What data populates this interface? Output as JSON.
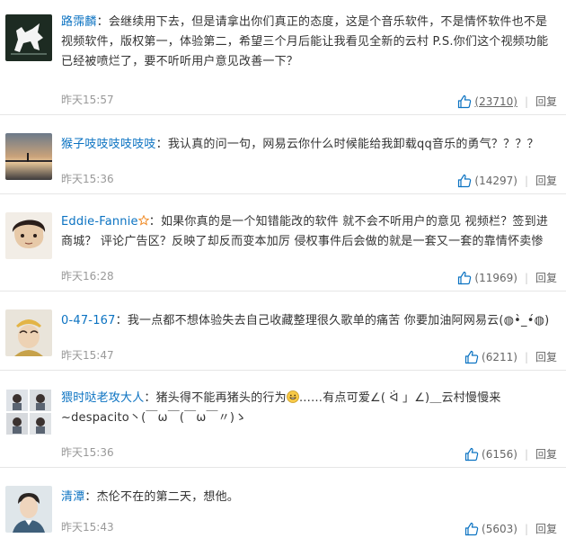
{
  "comments": [
    {
      "username": "路霈麟",
      "colon": "：",
      "text": "会继续用下去，但是请拿出你们真正的态度，这是个音乐软件，不是情怀软件也不是视频软件，版权第一，体验第二，希望三个月后能让我看见全新的云村 P.S.你们这个视频功能已经被喷烂了，要不听听用户意见改善一下？",
      "time": "昨天15:57",
      "likes": "(23710)",
      "reply": "回复",
      "avatar_icon": "white-dog-on-dark-avatar"
    },
    {
      "username": "猴子吱吱吱吱吱吱",
      "colon": "：",
      "text": "我认真的问一句，网易云你什么时候能给我卸载qq音乐的勇气？？？？",
      "time": "昨天15:36",
      "likes": "(14297)",
      "reply": "回复",
      "avatar_icon": "sunset-landscape-avatar"
    },
    {
      "username": "Eddie-Fannie",
      "colon": "：",
      "text": "如果你真的是一个知错能改的软件 就不会不听用户的意见 视频栏？签到进商城？ 评论广告区？反映了却反而变本加厉 侵权事件后会做的就是一套又一套的靠情怀卖惨",
      "time": "昨天16:28",
      "likes": "(11969)",
      "reply": "回复",
      "avatar_icon": "illustrated-face-avatar",
      "badge_icon": "star-badge-icon"
    },
    {
      "username": "0-47-167",
      "colon": "：",
      "text": "我一点都不想体验失去自己收藏整理很久歌单的痛苦 你要加油阿网易云(◍•̀_•́◍)",
      "time": "昨天15:47",
      "likes": "(6211)",
      "reply": "回复",
      "avatar_icon": "person-with-hat-avatar"
    },
    {
      "username": "猥时哒老攻大人",
      "colon": "：",
      "text_before": "猪头得不能再猪头的行为",
      "text_after": "……有点可爱∠( ᐛ 」∠)＿云村慢慢来~despacito丶(￣ω￣(￣ω￣〃)ゝ",
      "time": "昨天15:36",
      "likes": "(6156)",
      "reply": "回复",
      "avatar_icon": "four-panel-photo-avatar",
      "emoji_icon": "grinning-face-icon"
    },
    {
      "username": "清潭",
      "colon": "：",
      "text": "杰伦不在的第二天，想他。",
      "time": "昨天15:43",
      "likes": "(5603)",
      "reply": "回复",
      "avatar_icon": "young-man-portrait-avatar"
    }
  ],
  "colors": {
    "username": "#0c73c2",
    "text": "#333333",
    "meta": "#999999",
    "like_icon": "#0c73c2",
    "separator": "#cccccc"
  }
}
